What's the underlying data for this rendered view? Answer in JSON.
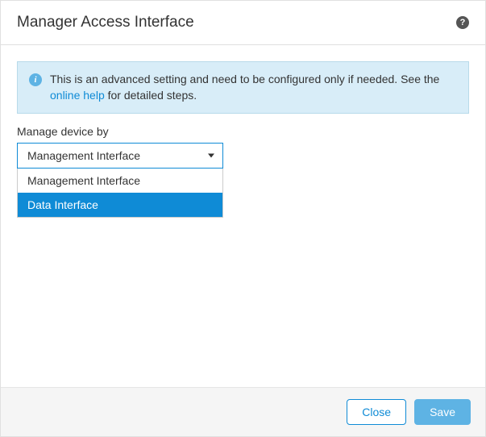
{
  "header": {
    "title": "Manager Access Interface",
    "help_symbol": "?"
  },
  "banner": {
    "info_symbol": "i",
    "text_before_link": "This is an advanced setting and need to be configured only if needed. See the ",
    "link_text": "online help",
    "text_after_link": " for detailed steps."
  },
  "field": {
    "label": "Manage device by",
    "selected": "Management Interface",
    "options": [
      {
        "label": "Management Interface",
        "highlighted": false
      },
      {
        "label": "Data Interface",
        "highlighted": true
      }
    ]
  },
  "footer": {
    "close_label": "Close",
    "save_label": "Save"
  }
}
